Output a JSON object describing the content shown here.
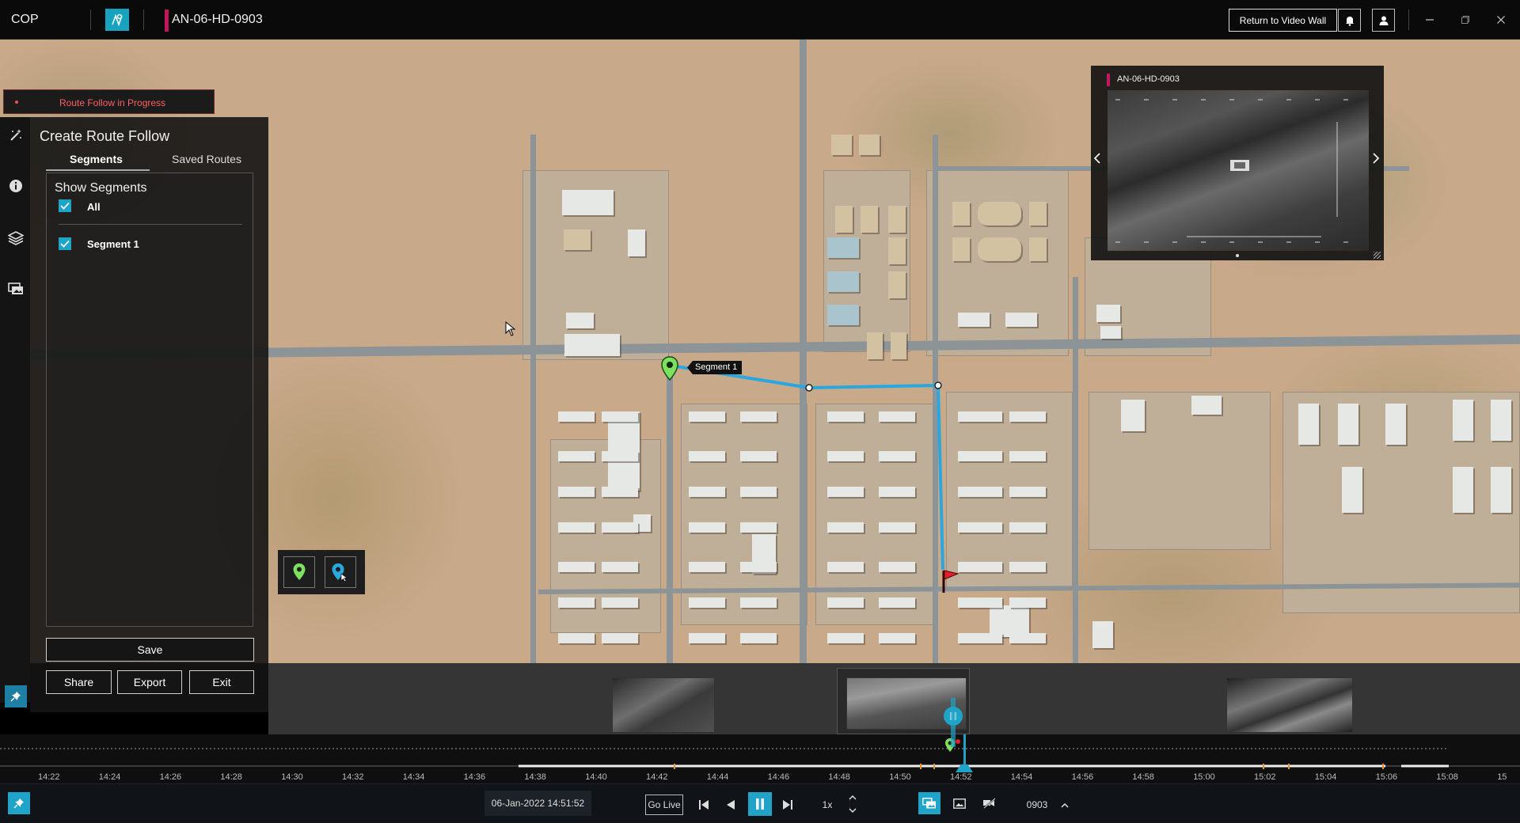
{
  "titlebar": {
    "app_name": "COP",
    "feed_title": "AN-06-HD-0903",
    "return_button": "Return to Video Wall",
    "icons": [
      "map-route-icon",
      "bell-icon",
      "user-icon",
      "minimize-icon",
      "restore-icon",
      "close-icon"
    ]
  },
  "left_panel": {
    "status": "Route Follow in Progress",
    "title": "Create Route Follow",
    "tabs": [
      {
        "label": "Segments",
        "active": true
      },
      {
        "label": "Saved Routes",
        "active": false
      }
    ],
    "show_segments_label": "Show Segments",
    "segments": [
      {
        "label": "All",
        "checked": true
      },
      {
        "label": "Segment 1",
        "checked": true
      }
    ],
    "buttons": {
      "save": "Save",
      "share": "Share",
      "export": "Export",
      "exit": "Exit"
    },
    "rail_icons": [
      "magic-wand-icon",
      "info-icon",
      "layers-icon",
      "gallery-icon",
      "pin-icon"
    ]
  },
  "map": {
    "route_label": "Segment 1",
    "route_color": "#29a8e0",
    "start_marker_color": "#7ee060",
    "end_marker_color": "#e0202a"
  },
  "preview": {
    "title": "AN-06-HD-0903"
  },
  "timeline": {
    "ticks": [
      "14:22",
      "14:24",
      "14:26",
      "14:28",
      "14:30",
      "14:32",
      "14:34",
      "14:36",
      "14:38",
      "14:40",
      "14:42",
      "14:44",
      "14:46",
      "14:48",
      "14:50",
      "14:52",
      "14:54",
      "14:56",
      "14:58",
      "15:00",
      "15:02",
      "15:04",
      "15:06",
      "15:08",
      "15"
    ],
    "datetime": "06-Jan-2022 14:51:52",
    "go_live": "Go Live",
    "speed": "1x",
    "feed_id": "0903",
    "accent": "#1fa3c7"
  }
}
